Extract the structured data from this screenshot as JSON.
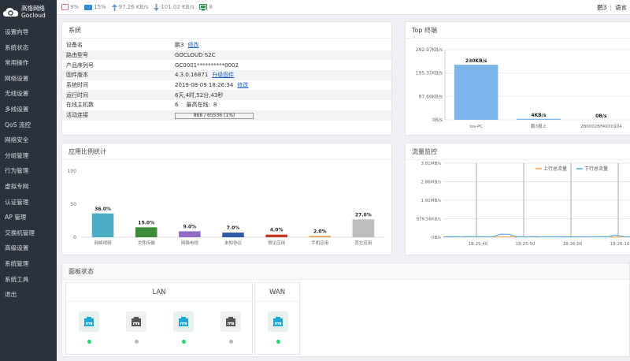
{
  "brand": {
    "cn": "高恪网络",
    "en": "Gocloud"
  },
  "nav": [
    "设置向导",
    "系统状态",
    "常用操作",
    "网络设置",
    "无线设置",
    "多线设置",
    "QoS 流控",
    "网络安全",
    "分组管理",
    "行为管理",
    "虚拟专网",
    "认证管理",
    "AP 管理",
    "交换机管理",
    "高级设置",
    "系统管理",
    "系统工具",
    "退出"
  ],
  "topbar": {
    "cpu": "9%",
    "mem": "15%",
    "up": "97.26 KB/s",
    "down": "101.02 KB/s",
    "devices": "8",
    "user": "鹏3",
    "lang": "语言"
  },
  "system": {
    "title": "系统",
    "rows": [
      {
        "k": "设备名",
        "v": "鹏3",
        "link": "修改"
      },
      {
        "k": "路由型号",
        "v": "GOCLOUD S2C",
        "link": ""
      },
      {
        "k": "产品序列号",
        "v": "GC0001**********0002",
        "link": ""
      },
      {
        "k": "固件版本",
        "v": "4.3.0.16871",
        "link": "升级固件"
      },
      {
        "k": "系统时间",
        "v": "2019-08-09 18:26:34",
        "link": "修改"
      },
      {
        "k": "运行时间",
        "v": "6天,4时,52分,43秒",
        "link": ""
      },
      {
        "k": "在线主机数",
        "v": "6",
        "extra_label": "最高在线:",
        "extra_value": "8",
        "link": ""
      },
      {
        "k": "活动连接",
        "bar": "868 / 65536 (1%)",
        "link": ""
      }
    ]
  },
  "top": {
    "title": "Top 终端"
  },
  "app": {
    "title": "应用比例统计"
  },
  "flow": {
    "title": "流量监控",
    "legend_up": "上行总流量",
    "legend_down": "下行总流量"
  },
  "board": {
    "title": "面板状态",
    "lan": "LAN",
    "wan": "WAN"
  },
  "colors": {
    "sidebar": "#2b323d",
    "up": "#f5a14f",
    "down": "#4aa3df",
    "link": "#1a5fc8",
    "online": "#20d36a",
    "offline": "#b8b8b8"
  },
  "chart_data": [
    {
      "type": "bar",
      "title": "Top 终端",
      "categories": [
        "ios-PC",
        "鹏3报上",
        "2B0002BFAK00104"
      ],
      "values": [
        230,
        4,
        0
      ],
      "value_labels": [
        "230KB/s",
        "4KB/s",
        "0B/s"
      ],
      "yticks": [
        "0B/s",
        "97.66KB/s",
        "195.31KB/s",
        "292.97KB/s"
      ],
      "ylim": [
        0,
        292.97
      ]
    },
    {
      "type": "bar",
      "title": "应用比例统计",
      "categories": [
        "网络视频",
        "文件传输",
        "网络电视",
        "未知协议",
        "常见应用",
        "手机应用",
        "其它应用"
      ],
      "values": [
        36.0,
        15.0,
        9.0,
        7.0,
        4.0,
        2.0,
        27.0
      ],
      "value_labels": [
        "36.0%",
        "15.0%",
        "9.0%",
        "7.0%",
        "4.0%",
        "2.0%",
        "27.0%"
      ],
      "colors": [
        "#4bacc6",
        "#3e8c3a",
        "#8f6cc2",
        "#2f5aa8",
        "#c0392b",
        "#e69c4e",
        "#bdbdbd"
      ],
      "yticks": [
        "0",
        "50",
        "100"
      ],
      "ylim": [
        0,
        100
      ]
    },
    {
      "type": "line",
      "title": "流量监控",
      "xticks": [
        "18:25:40",
        "18:25:50",
        "18:26:00",
        "18:26:10"
      ],
      "yticks": [
        "0B/s",
        "976.56KB/s",
        "1.91MB/s",
        "2.86MB/s",
        "3.81MB/s"
      ],
      "ylim": [
        0,
        3.81
      ],
      "series": [
        {
          "name": "上行总流量",
          "color": "#f5a14f",
          "values": [
            0.02,
            0.03,
            0.02,
            0.02,
            0.03,
            0.02,
            0.02,
            0.03,
            0.02,
            0.02,
            0.02,
            0.03,
            0.02,
            0.02,
            0.02,
            0.03,
            0.02,
            0.02,
            0.02,
            0.02,
            0.03,
            0.02,
            0.02,
            0.02
          ]
        },
        {
          "name": "下行总流量",
          "color": "#4aa3df",
          "values": [
            0.02,
            0.02,
            0.02,
            0.04,
            0.02,
            0.02,
            0.03,
            0.16,
            0.15,
            0.02,
            0.02,
            0.03,
            0.02,
            0.02,
            0.02,
            0.02,
            0.02,
            0.03,
            0.02,
            0.02,
            0.02,
            0.12,
            0.03,
            0.02
          ]
        }
      ]
    }
  ],
  "ports": {
    "lan": [
      "on",
      "off",
      "on",
      "off"
    ],
    "wan": [
      "on"
    ]
  }
}
